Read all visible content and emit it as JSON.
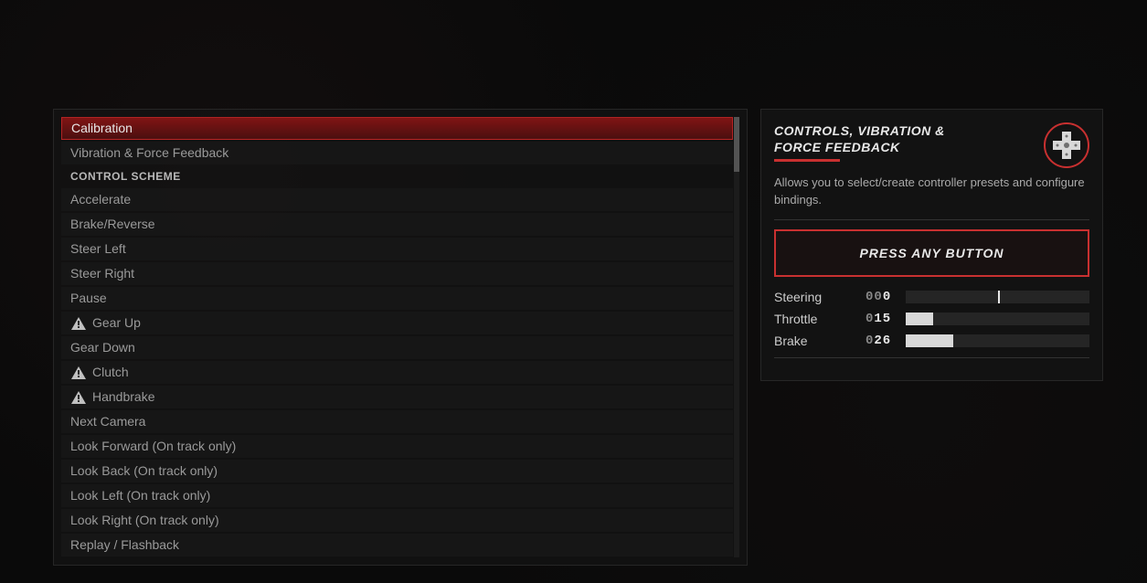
{
  "main_menu": {
    "top_items": [
      {
        "label": "Calibration",
        "selected": true
      },
      {
        "label": "Vibration & Force Feedback",
        "selected": false
      }
    ],
    "section_header": "CONTROL SCHEME",
    "bindings": [
      {
        "label": "Accelerate",
        "warning": false
      },
      {
        "label": "Brake/Reverse",
        "warning": false
      },
      {
        "label": "Steer Left",
        "warning": false
      },
      {
        "label": "Steer Right",
        "warning": false
      },
      {
        "label": "Pause",
        "warning": false
      },
      {
        "label": "Gear Up",
        "warning": true
      },
      {
        "label": "Gear Down",
        "warning": false
      },
      {
        "label": "Clutch",
        "warning": true
      },
      {
        "label": "Handbrake",
        "warning": true
      },
      {
        "label": "Next Camera",
        "warning": false
      },
      {
        "label": "Look Forward (On track only)",
        "warning": false
      },
      {
        "label": "Look Back (On track only)",
        "warning": false
      },
      {
        "label": "Look Left (On track only)",
        "warning": false
      },
      {
        "label": "Look Right (On track only)",
        "warning": false
      },
      {
        "label": "Replay / Flashback",
        "warning": false
      }
    ]
  },
  "right_panel": {
    "title": "CONTROLS, VIBRATION & FORCE FEEDBACK",
    "description": "Allows you to select/create controller presets and configure bindings.",
    "press_button": "PRESS ANY BUTTON",
    "inputs": [
      {
        "label": "Steering",
        "dim": "00",
        "bright": "0",
        "percent": 0,
        "centered": true
      },
      {
        "label": "Throttle",
        "dim": "0",
        "bright": "15",
        "percent": 15,
        "centered": false
      },
      {
        "label": "Brake",
        "dim": "0",
        "bright": "26",
        "percent": 26,
        "centered": false
      }
    ]
  }
}
